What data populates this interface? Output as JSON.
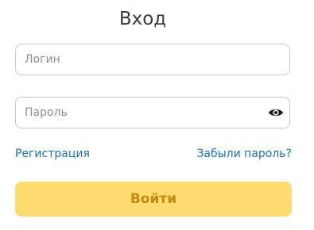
{
  "form": {
    "title": "Вход",
    "login": {
      "value": "",
      "placeholder": "Логин"
    },
    "password": {
      "value": "",
      "placeholder": "Пароль"
    },
    "show_password_icon": "eye-icon",
    "register_link": "Регистрация",
    "forgot_link": "Забыли пароль?",
    "submit_label": "Войти"
  },
  "colors": {
    "link": "#1f6fb2",
    "button_bg": "#ffdb70",
    "button_text": "#c48a12",
    "border": "#c9c9c9"
  }
}
